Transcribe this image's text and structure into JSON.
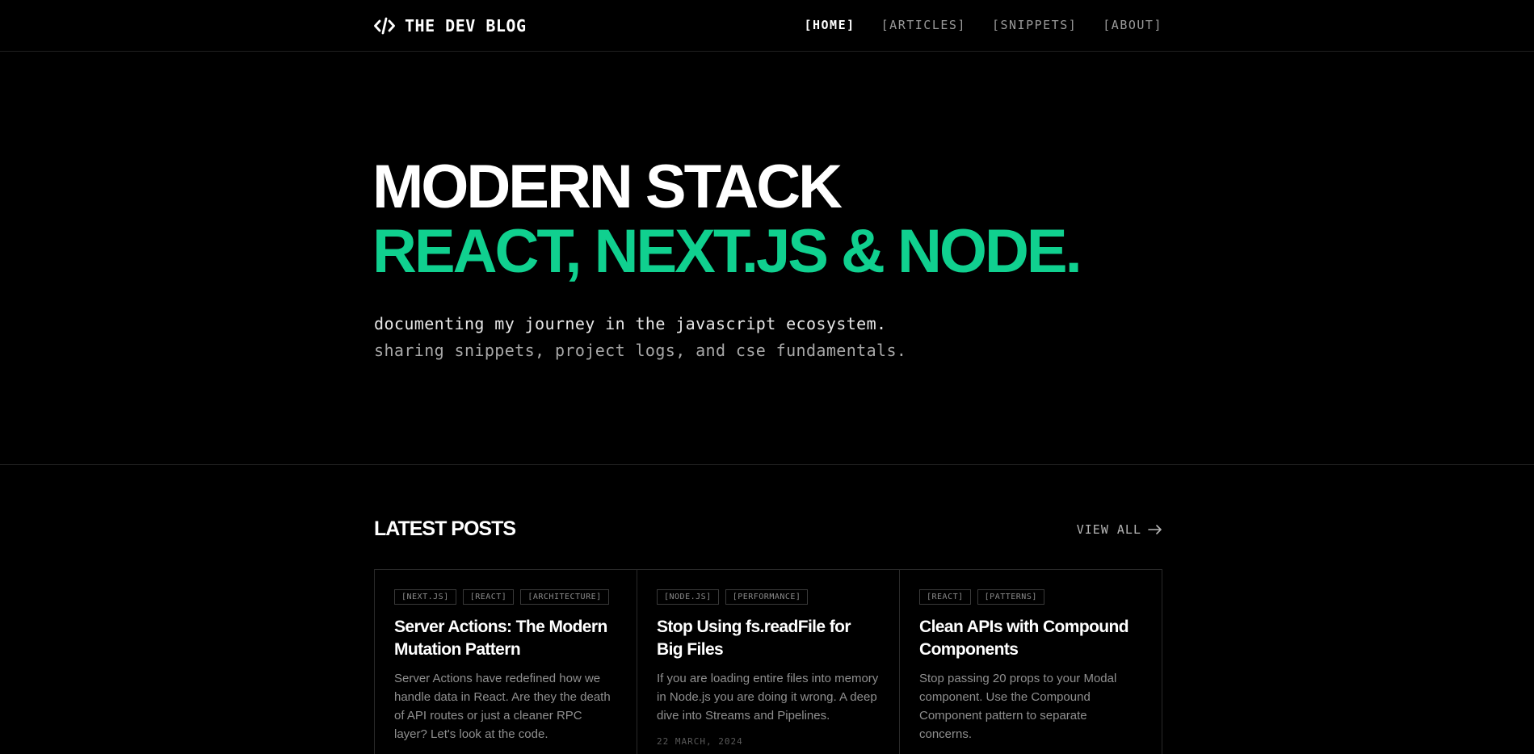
{
  "brand": {
    "name": "THE DEV BLOG",
    "icon": "code-brackets-icon"
  },
  "nav": {
    "items": [
      {
        "label": "[HOME]",
        "active": true
      },
      {
        "label": "[ARTICLES]",
        "active": false
      },
      {
        "label": "[SNIPPETS]",
        "active": false
      },
      {
        "label": "[ABOUT]",
        "active": false
      }
    ]
  },
  "hero": {
    "line1": "MODERN STACK",
    "line2": "REACT, NEXT.JS & NODE.",
    "sub1": "documenting my journey in the javascript ecosystem.",
    "sub2": "sharing snippets, project logs, and cse fundamentals."
  },
  "posts": {
    "title": "LATEST POSTS",
    "view_all": "VIEW ALL",
    "view_all_icon": "arrow-right-icon",
    "items": [
      {
        "tags": [
          "[NEXT.JS]",
          "[REACT]",
          "[ARCHITECTURE]"
        ],
        "title": "Server Actions: The Modern Mutation Pattern",
        "excerpt": "Server Actions have redefined how we handle data in React. Are they the death of API routes or just a cleaner RPC layer? Let's look at the code."
      },
      {
        "tags": [
          "[NODE.JS]",
          "[PERFORMANCE]"
        ],
        "title": "Stop Using fs.readFile for Big Files",
        "excerpt": "If you are loading entire files into memory in Node.js you are doing it wrong. A deep dive into Streams and Pipelines.",
        "date": "22 MARCH, 2024"
      },
      {
        "tags": [
          "[REACT]",
          "[PATTERNS]"
        ],
        "title": "Clean APIs with Compound Components",
        "excerpt": "Stop passing 20 props to your Modal component. Use the Compound Component pattern to separate concerns."
      }
    ]
  },
  "colors": {
    "accent": "#10d08f",
    "background": "#000000",
    "border": "#2a2a2a"
  }
}
